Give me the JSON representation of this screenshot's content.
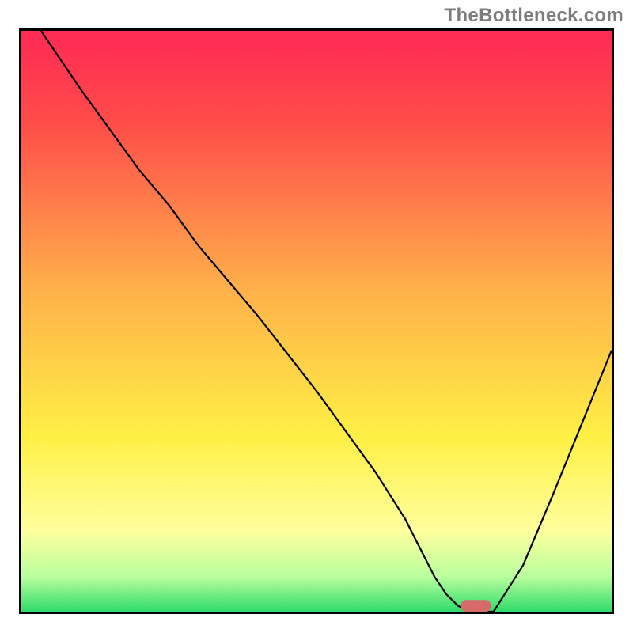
{
  "watermark": "TheBottleneck.com",
  "colors": {
    "gradient_top": "#ff2a55",
    "gradient_red": "#ff4a4a",
    "gradient_orange": "#ffb24a",
    "gradient_yellow": "#fff045",
    "gradient_paleyellow": "#ffff9e",
    "gradient_palegreen": "#b9ff9e",
    "gradient_green": "#2fdb6a",
    "curve": "#000000",
    "marker": "#d66a6a",
    "border": "#000000"
  },
  "chart_data": {
    "type": "line",
    "title": "",
    "xlabel": "",
    "ylabel": "",
    "xlim": [
      0,
      100
    ],
    "ylim": [
      0,
      100
    ],
    "x": [
      0,
      10,
      20,
      25,
      30,
      40,
      50,
      55,
      60,
      65,
      68,
      70,
      72,
      74,
      76,
      80,
      85,
      90,
      100
    ],
    "y": [
      105,
      90,
      76,
      70,
      63,
      51,
      38,
      31,
      24,
      16,
      10,
      6,
      3,
      1,
      0,
      0,
      8,
      20,
      45
    ],
    "marker": {
      "x": 77,
      "y": 0,
      "width": 5,
      "height": 2
    },
    "annotations": []
  }
}
